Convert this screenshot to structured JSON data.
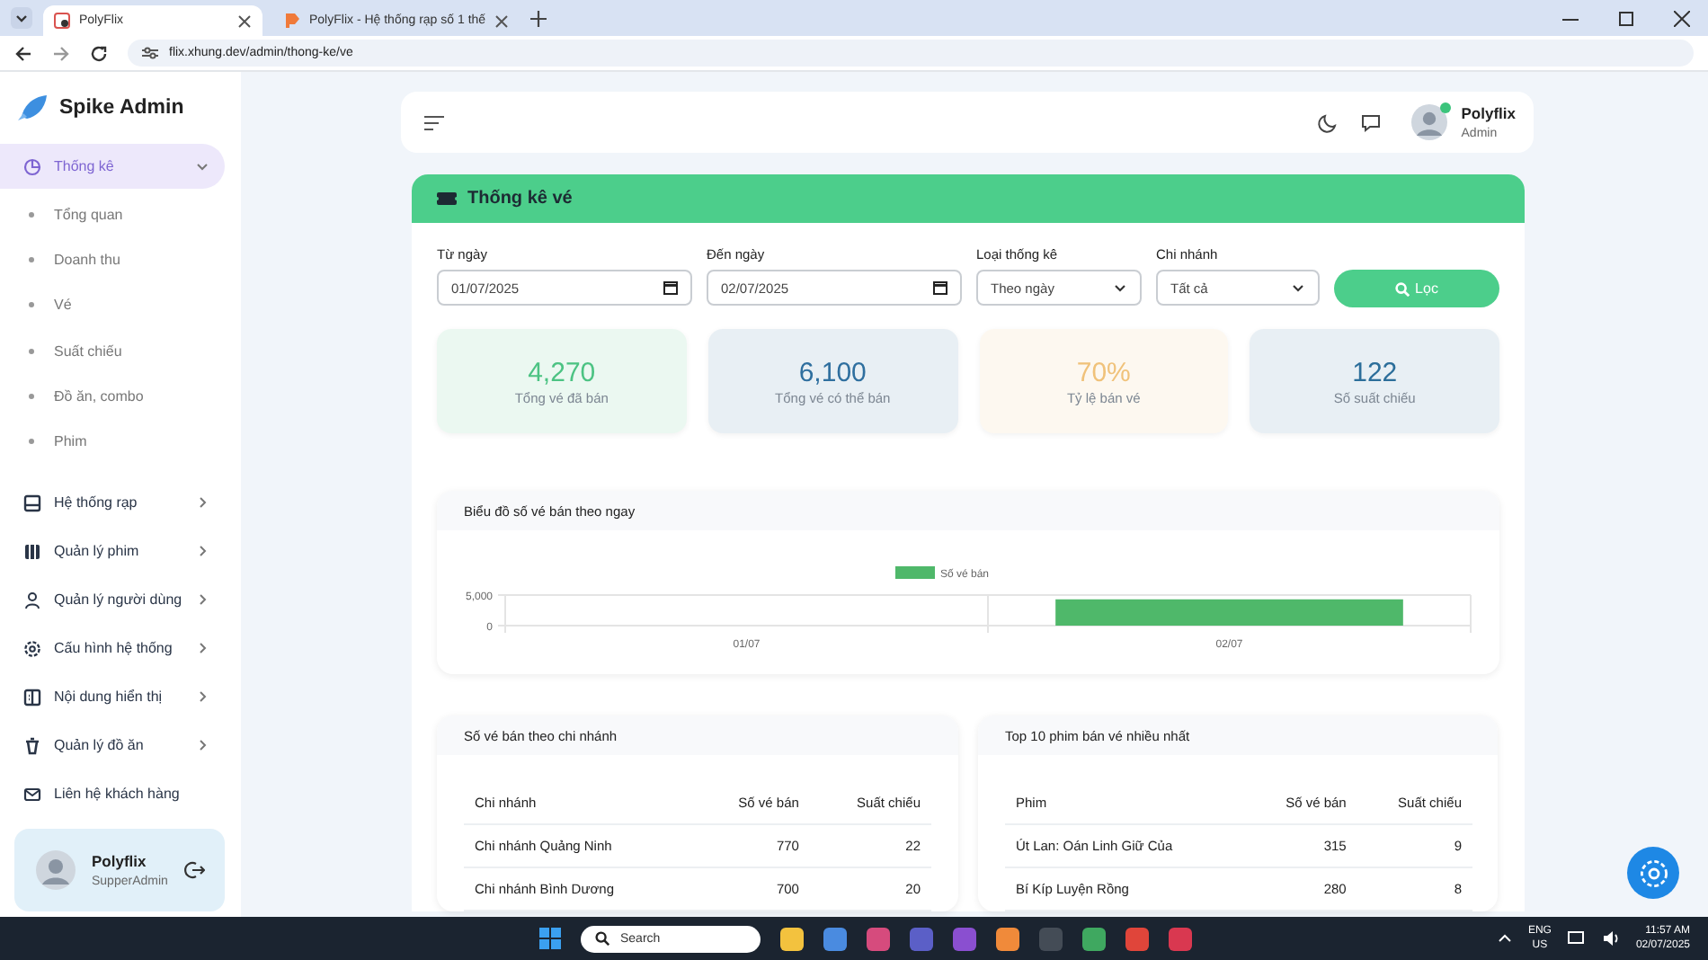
{
  "browser": {
    "tabs": [
      {
        "title": "PolyFlix",
        "selected": true
      },
      {
        "title": "PolyFlix - Hệ thống rạp số 1 thế",
        "selected": false
      }
    ],
    "url": "flix.xhung.dev/admin/thong-ke/ve"
  },
  "sidebar": {
    "brand": "Spike Admin",
    "items": [
      {
        "label": "Thống kê",
        "selected": true,
        "expanded": true,
        "children": [
          {
            "label": "Tổng quan"
          },
          {
            "label": "Doanh thu"
          },
          {
            "label": "Vé"
          },
          {
            "label": "Suất chiếu"
          },
          {
            "label": "Đồ ăn, combo"
          },
          {
            "label": "Phim"
          }
        ]
      },
      {
        "label": "Hệ thống rạp",
        "selected": false,
        "expanded": false
      },
      {
        "label": "Quản lý phim",
        "selected": false,
        "expanded": false
      },
      {
        "label": "Quản lý người dùng",
        "selected": false,
        "expanded": false
      },
      {
        "label": "Cấu hình hệ thống",
        "selected": false,
        "expanded": false
      },
      {
        "label": "Nội dung hiển thị",
        "selected": false,
        "expanded": false
      },
      {
        "label": "Quản lý đồ ăn",
        "selected": false,
        "expanded": false
      },
      {
        "label": "Liên hệ khách hàng",
        "selected": false
      }
    ],
    "user": {
      "name": "Polyflix",
      "role": "SupperAdmin"
    }
  },
  "header": {
    "user": {
      "name": "Polyflix",
      "role": "Admin",
      "online": true
    }
  },
  "panel": {
    "title": "Thống kê vé",
    "filters": [
      {
        "kind": "date",
        "label": "Từ ngày",
        "value": "01/07/2025"
      },
      {
        "kind": "date",
        "label": "Đến ngày",
        "value": "02/07/2025"
      },
      {
        "kind": "select",
        "label": "Loại thống kê",
        "value": "Theo ngày"
      },
      {
        "kind": "select",
        "label": "Chi nhánh",
        "value": "Tất cả"
      }
    ],
    "filter_button": "Lọc",
    "stats": [
      {
        "value": "4,270",
        "label": "Tổng vé đã bán",
        "color": "#4cc383"
      },
      {
        "value": "6,100",
        "label": "Tổng vé có thể bán",
        "color": "#2f6f9f"
      },
      {
        "value": "70%",
        "label": "Tỷ lệ bán vé",
        "color": "#f0c27a"
      },
      {
        "value": "122",
        "label": "Số suất chiếu",
        "color": "#2c6e9a"
      }
    ],
    "chart_card": {
      "title": "Biểu đồ số vé bán theo ngay",
      "chart_data": {
        "type": "bar",
        "categories": [
          "01/07",
          "02/07"
        ],
        "series": [
          {
            "name": "Số vé bán",
            "color": "#4fb86a",
            "values": [
              0,
              4300
            ]
          }
        ],
        "ylim": [
          0,
          5000
        ],
        "yticks": [
          {
            "value": 0,
            "label": "0"
          },
          {
            "value": 5000,
            "label": "5,000"
          }
        ]
      }
    },
    "tables": [
      {
        "title": "Số vé bán theo chi nhánh",
        "columns": [
          "Chi nhánh",
          "Số vé bán",
          "Suất chiếu"
        ],
        "rows": [
          [
            "Chi nhánh Quảng Ninh",
            "770",
            "22"
          ],
          [
            "Chi nhánh Bình Dương",
            "700",
            "20"
          ]
        ]
      },
      {
        "title": "Top 10 phim bán vé nhiều nhất",
        "columns": [
          "Phim",
          "Số vé bán",
          "Suất chiếu"
        ],
        "rows": [
          [
            "Út Lan: Oán Linh Giữ Của",
            "315",
            "9"
          ],
          [
            "Bí Kíp Luyện Rồng",
            "280",
            "8"
          ]
        ]
      }
    ]
  },
  "taskbar": {
    "search_placeholder": "Search",
    "language": [
      "ENG",
      "US"
    ],
    "time": "11:57 AM",
    "date": "02/07/2025"
  }
}
